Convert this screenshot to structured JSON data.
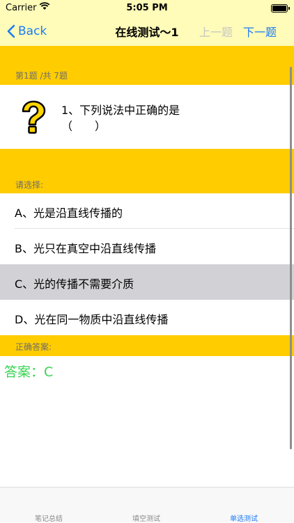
{
  "status": {
    "carrier": "Carrier",
    "time": "5:05 PM"
  },
  "nav": {
    "back": "Back",
    "title": "在线测试～1",
    "prev": "上一题",
    "next": "下一题"
  },
  "question": {
    "counter": "第1题 /共 7题",
    "line1": "1、下列说法中正确的是",
    "line2": "（　　）"
  },
  "options_header": "请选择:",
  "options": [
    {
      "label": "A、光是沿直线传播的",
      "selected": false
    },
    {
      "label": "B、光只在真空中沿直线传播",
      "selected": false
    },
    {
      "label": "C、光的传播不需要介质",
      "selected": true
    },
    {
      "label": "D、光在同一物质中沿直线传播",
      "selected": false
    }
  ],
  "answer_header": "正确答案:",
  "answer": "答案：C",
  "tabs": [
    {
      "label": "笔记总结",
      "active": false
    },
    {
      "label": "填空测试",
      "active": false
    },
    {
      "label": "单选测试",
      "active": true
    }
  ],
  "colors": {
    "accent": "#1a7cf5",
    "header": "#ffcc00",
    "navbar": "#fffbb8",
    "answer": "#39d353",
    "selected": "#d2d1d6"
  }
}
